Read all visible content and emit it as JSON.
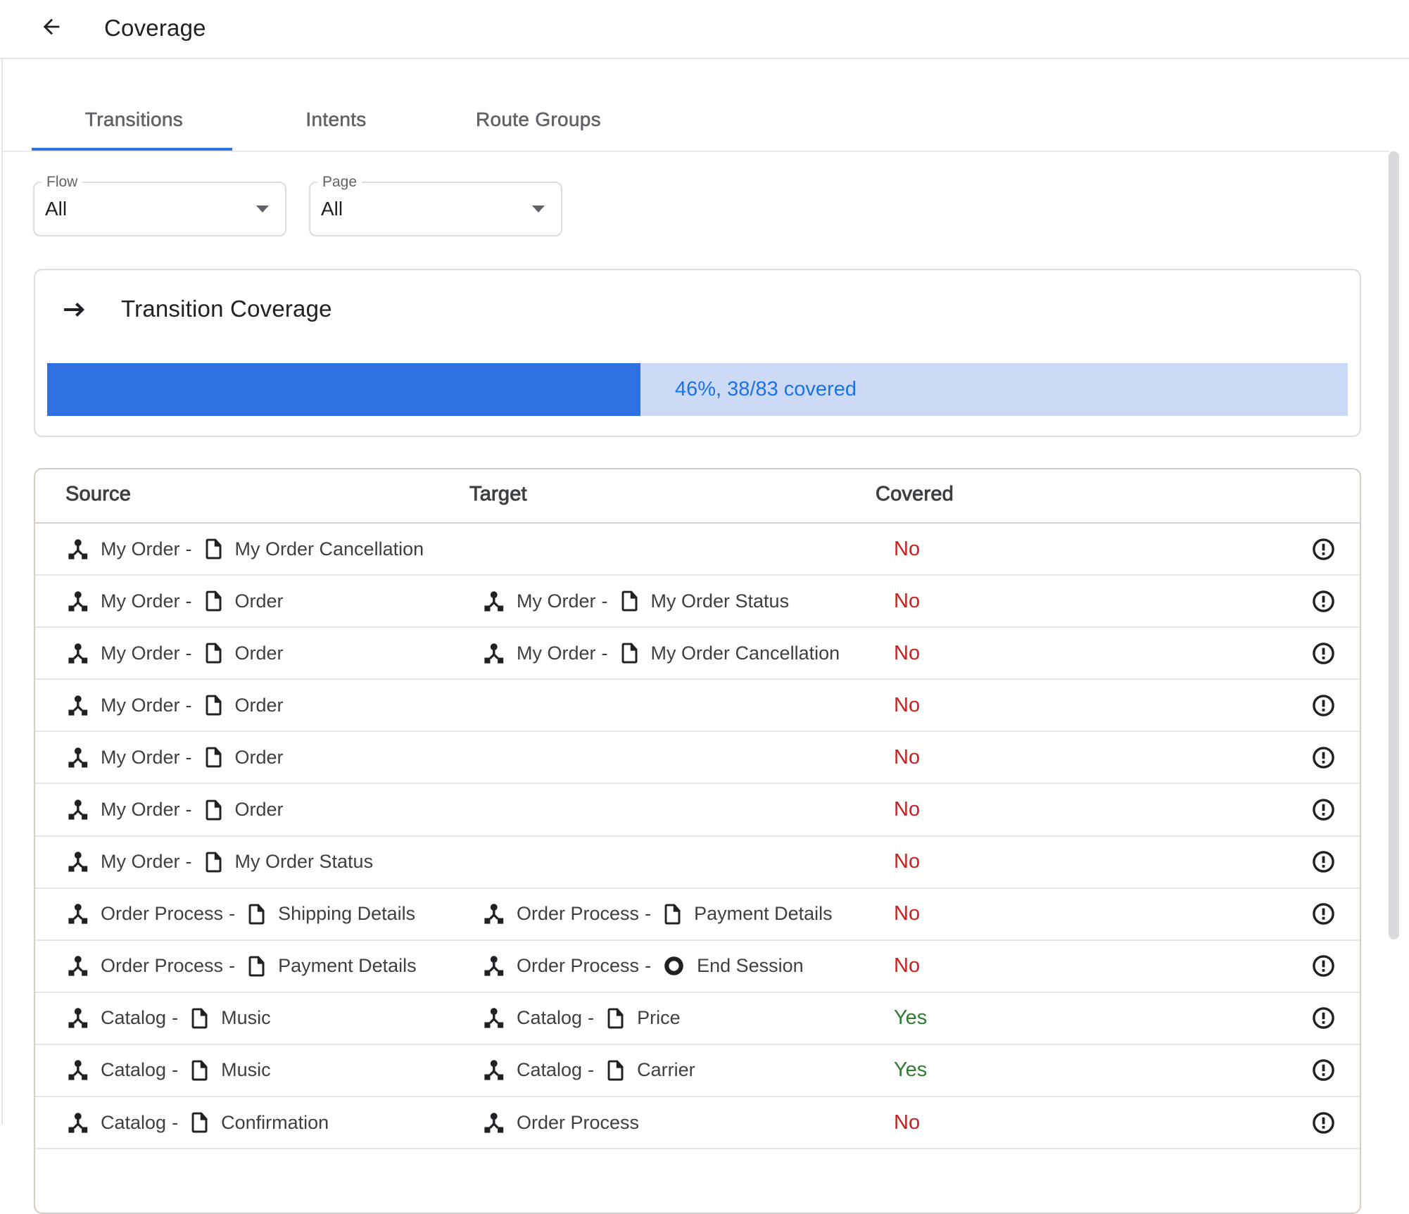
{
  "colors": {
    "accent_blue": "#1a73e8",
    "bar_blue": "#3071e2",
    "bar_track": "#ccdaf5",
    "no_red": "#c5221f",
    "yes_green": "#2e7d32"
  },
  "header": {
    "title": "Coverage"
  },
  "tabs": [
    {
      "label": "Transitions",
      "active": true
    },
    {
      "label": "Intents",
      "active": false
    },
    {
      "label": "Route Groups",
      "active": false
    }
  ],
  "filters": {
    "flow": {
      "label": "Flow",
      "value": "All"
    },
    "page": {
      "label": "Page",
      "value": "All"
    }
  },
  "coverage_card": {
    "title": "Transition Coverage",
    "percent": 46,
    "fill_percent": 45.6,
    "progress_label": "46%, 38/83 covered"
  },
  "table": {
    "columns": {
      "source": "Source",
      "target": "Target",
      "covered": "Covered"
    },
    "rows": [
      {
        "source": {
          "flow": "My Order",
          "page": "My Order Cancellation"
        },
        "target": null,
        "covered": "No"
      },
      {
        "source": {
          "flow": "My Order",
          "page": "Order"
        },
        "target": {
          "flow": "My Order",
          "page": "My Order Status"
        },
        "covered": "No"
      },
      {
        "source": {
          "flow": "My Order",
          "page": "Order"
        },
        "target": {
          "flow": "My Order",
          "page": "My Order Cancellation"
        },
        "covered": "No"
      },
      {
        "source": {
          "flow": "My Order",
          "page": "Order"
        },
        "target": null,
        "covered": "No"
      },
      {
        "source": {
          "flow": "My Order",
          "page": "Order"
        },
        "target": null,
        "covered": "No"
      },
      {
        "source": {
          "flow": "My Order",
          "page": "Order"
        },
        "target": null,
        "covered": "No"
      },
      {
        "source": {
          "flow": "My Order",
          "page": "My Order Status"
        },
        "target": null,
        "covered": "No"
      },
      {
        "source": {
          "flow": "Order Process",
          "page": "Shipping Details"
        },
        "target": {
          "flow": "Order Process",
          "page": "Payment Details"
        },
        "covered": "No"
      },
      {
        "source": {
          "flow": "Order Process",
          "page": "Payment Details"
        },
        "target": {
          "flow": "Order Process",
          "page": "End Session",
          "page_icon": "end-session"
        },
        "covered": "No"
      },
      {
        "source": {
          "flow": "Catalog",
          "page": "Music"
        },
        "target": {
          "flow": "Catalog",
          "page": "Price"
        },
        "covered": "Yes"
      },
      {
        "source": {
          "flow": "Catalog",
          "page": "Music"
        },
        "target": {
          "flow": "Catalog",
          "page": "Carrier"
        },
        "covered": "Yes"
      },
      {
        "source": {
          "flow": "Catalog",
          "page": "Confirmation"
        },
        "target": {
          "flow": "Order Process"
        },
        "covered": "No"
      }
    ]
  }
}
